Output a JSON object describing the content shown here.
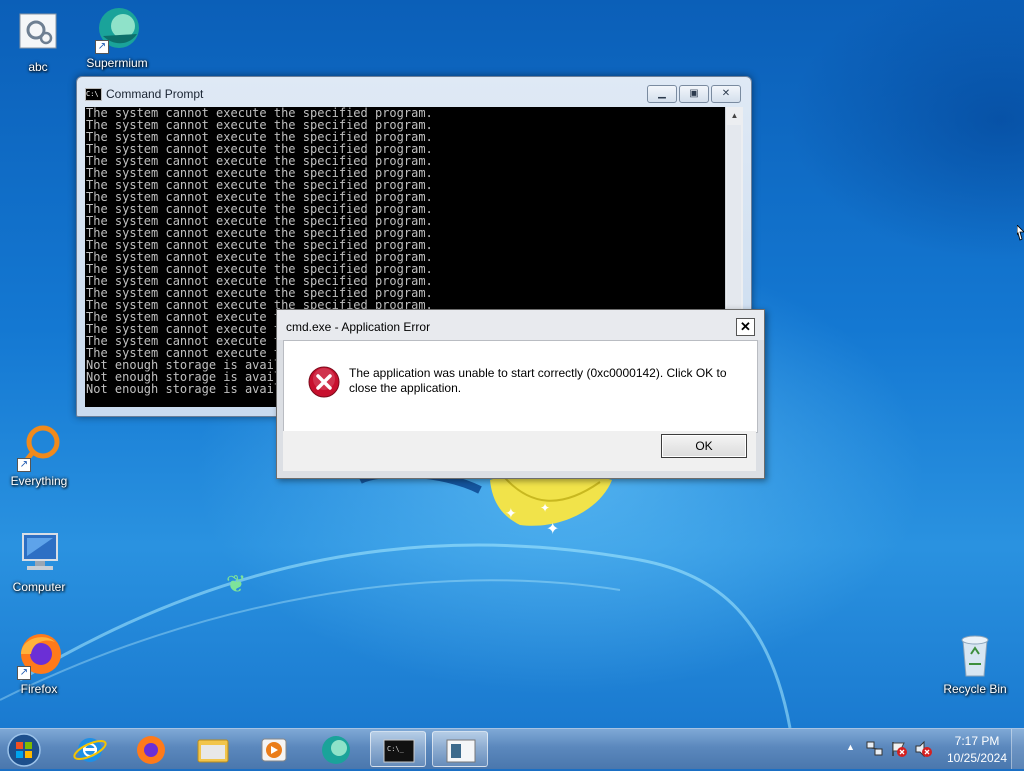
{
  "desktop": {
    "icons": [
      {
        "label": "abc"
      },
      {
        "label": "Supermium"
      },
      {
        "label": "Everything"
      },
      {
        "label": "Computer"
      },
      {
        "label": "Firefox"
      },
      {
        "label": "Recycle Bin"
      }
    ]
  },
  "cmd_window": {
    "title": "Command Prompt",
    "icon_text": "C:\\",
    "lines": [
      "The system cannot execute the specified program.",
      "The system cannot execute the specified program.",
      "The system cannot execute the specified program.",
      "The system cannot execute the specified program.",
      "The system cannot execute the specified program.",
      "The system cannot execute the specified program.",
      "The system cannot execute the specified program.",
      "The system cannot execute the specified program.",
      "The system cannot execute the specified program.",
      "The system cannot execute the specified program.",
      "The system cannot execute the specified program.",
      "The system cannot execute the specified program.",
      "The system cannot execute the specified program.",
      "The system cannot execute the specified program.",
      "The system cannot execute the specified program.",
      "The system cannot execute the specified program.",
      "The system cannot execute the specified program.",
      "The system cannot execute the specified program.",
      "The system cannot execute the specified program.",
      "The system cannot execute the specified program.",
      "The system cannot execute the specified program.",
      "Not enough storage is available to process this command.",
      "Not enough storage is available to process this command.",
      "Not enough storage is available to process this command."
    ]
  },
  "error_dialog": {
    "title": "cmd.exe - Application Error",
    "message": "The application was unable to start correctly (0xc0000142). Click OK to close the application.",
    "ok_label": "OK",
    "close_glyph": "✕"
  },
  "taskbar": {
    "pinned": [
      {
        "name": "internet-explorer"
      },
      {
        "name": "firefox"
      },
      {
        "name": "file-explorer"
      },
      {
        "name": "media-player"
      },
      {
        "name": "supermium"
      },
      {
        "name": "command-prompt"
      },
      {
        "name": "application-error"
      }
    ],
    "clock_time": "7:17 PM",
    "clock_date": "10/25/2024",
    "tray_arrow": "▲"
  },
  "colors": {
    "console_bg": "#000000",
    "console_text": "#c0c0c0",
    "error_red": "#c8102e",
    "taskbar": "#5b88bd"
  }
}
